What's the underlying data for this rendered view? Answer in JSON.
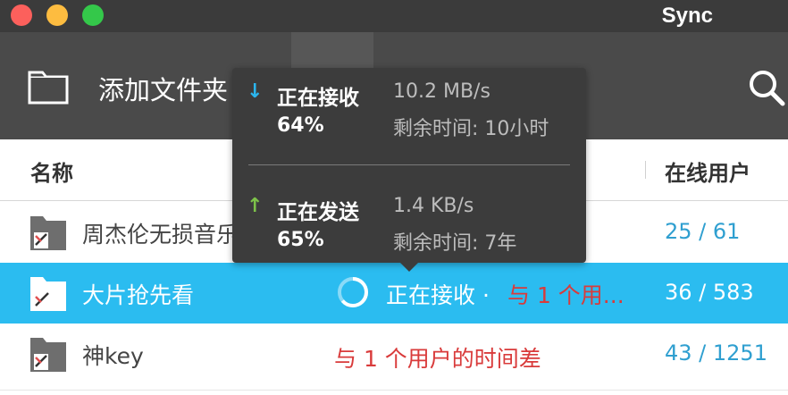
{
  "window": {
    "title": "Sync"
  },
  "toolbar": {
    "add_label": "添加文件夹"
  },
  "table": {
    "header_name": "名称",
    "header_online": "在线用户",
    "rows": [
      {
        "name": "周杰伦无损音乐",
        "status": "",
        "time_diff": "",
        "users": "25 / 61"
      },
      {
        "name": "大片抢先看",
        "status": "正在接收 ·",
        "time_diff": "与 1 个用...",
        "users": "36 / 583"
      },
      {
        "name": "神key",
        "status": "",
        "time_diff": "与 1 个用户的时间差",
        "users": "43 / 1251"
      }
    ]
  },
  "popover": {
    "receiving": {
      "label": "正在接收",
      "percent_text": "64%",
      "percent": 64,
      "speed": "10.2 MB/s",
      "remaining": "剩余时间: 10小时"
    },
    "sending": {
      "label": "正在发送",
      "percent_text": "65%",
      "percent": 65,
      "speed": "1.4 KB/s",
      "remaining": "剩余时间: 7年"
    }
  },
  "colors": {
    "selected_row": "#2bbcf0",
    "users_link": "#2f9fd0",
    "warning": "#d93b3b",
    "receive_arrow": "#2bb6ee",
    "send_arrow": "#7dc24a"
  },
  "icons": [
    "close-icon",
    "minimize-icon",
    "zoom-icon",
    "folder-icon",
    "search-icon",
    "shared-folder-icon",
    "progress-ring-icon",
    "arrow-down-icon",
    "arrow-up-icon"
  ]
}
